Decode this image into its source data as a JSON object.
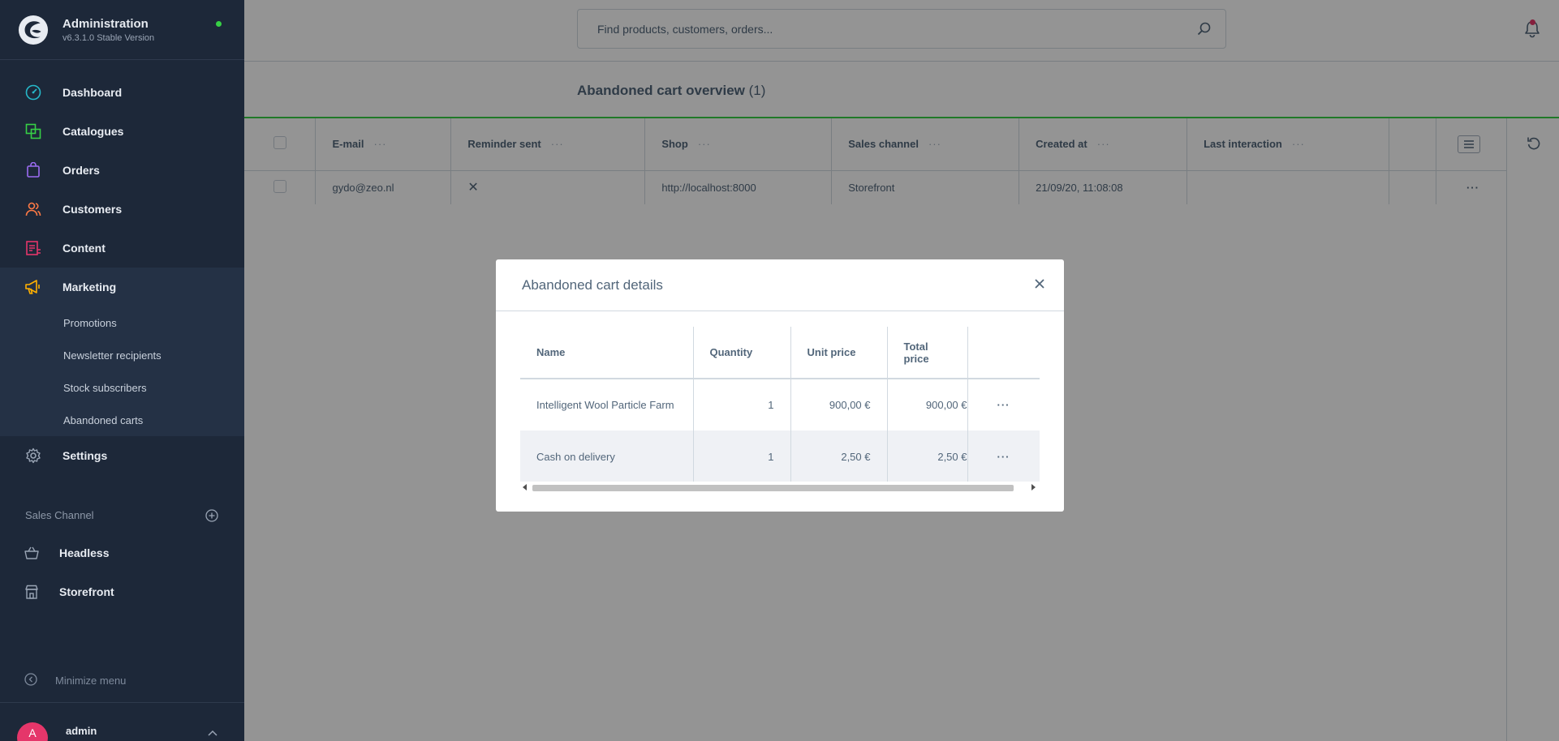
{
  "app": {
    "title": "Administration",
    "version": "v6.3.1.0 Stable Version"
  },
  "nav": {
    "items": [
      {
        "label": "Dashboard",
        "icon": "dashboard-icon",
        "color": "#26b8c9"
      },
      {
        "label": "Catalogues",
        "icon": "catalogue-icon",
        "color": "#37d046"
      },
      {
        "label": "Orders",
        "icon": "orders-icon",
        "color": "#9b6cf2"
      },
      {
        "label": "Customers",
        "icon": "customers-icon",
        "color": "#ff7a45"
      },
      {
        "label": "Content",
        "icon": "content-icon",
        "color": "#e5366a"
      },
      {
        "label": "Marketing",
        "icon": "megaphone-icon",
        "color": "#ffb000"
      }
    ],
    "marketing_sub": [
      {
        "label": "Promotions"
      },
      {
        "label": "Newsletter recipients"
      },
      {
        "label": "Stock subscribers"
      },
      {
        "label": "Abandoned carts"
      }
    ],
    "settings": {
      "label": "Settings",
      "icon": "gear-icon"
    }
  },
  "sales_channel": {
    "title": "Sales Channel",
    "items": [
      {
        "label": "Headless",
        "icon": "basket-icon"
      },
      {
        "label": "Storefront",
        "icon": "storefront-icon"
      }
    ]
  },
  "minimize_label": "Minimize menu",
  "user": {
    "initial": "A",
    "name": "admin"
  },
  "search": {
    "placeholder": "Find products, customers, orders..."
  },
  "page": {
    "title": "Abandoned cart overview",
    "count": "(1)"
  },
  "grid": {
    "columns": [
      "E-mail",
      "Reminder sent",
      "Shop",
      "Sales channel",
      "Created at",
      "Last interaction"
    ],
    "rows": [
      {
        "email": "gydo@zeo.nl",
        "reminder_sent": "✕",
        "shop": "http://localhost:8000",
        "sales_channel": "Storefront",
        "created_at": "21/09/20, 11:08:08",
        "last_interaction": ""
      }
    ]
  },
  "modal": {
    "title": "Abandoned cart details",
    "columns": [
      "Name",
      "Quantity",
      "Unit price",
      "Total price"
    ],
    "rows": [
      {
        "name": "Intelligent Wool Particle Farm",
        "quantity": "1",
        "unit_price": "900,00 €",
        "total_price": "900,00 €"
      },
      {
        "name": "Cash on delivery",
        "quantity": "1",
        "unit_price": "2,50 €",
        "total_price": "2,50 €"
      }
    ]
  },
  "colors": {
    "sidebar_bg": "#1d2839",
    "accent_green": "#37d046",
    "text": "#52667a"
  }
}
